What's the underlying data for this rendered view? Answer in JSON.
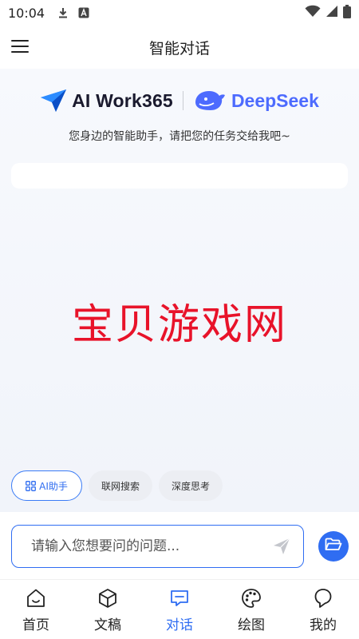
{
  "status_bar": {
    "time": "10:04"
  },
  "header": {
    "title": "智能对话"
  },
  "brand": {
    "left_name": "AI Work365",
    "right_name": "DeepSeek"
  },
  "tagline": "您身边的智能助手，请把您的任务交给我吧~",
  "watermark": "宝贝游戏网",
  "chips": [
    {
      "label": "AI助手",
      "icon": "grid-icon",
      "active": true
    },
    {
      "label": "联网搜索",
      "active": false
    },
    {
      "label": "深度思考",
      "active": false
    }
  ],
  "input": {
    "placeholder": "请输入您想要问的问题...",
    "value": ""
  },
  "tabs": [
    {
      "label": "首页",
      "icon": "home-icon",
      "active": false
    },
    {
      "label": "文稿",
      "icon": "cube-icon",
      "active": false
    },
    {
      "label": "对话",
      "icon": "chat-icon",
      "active": true
    },
    {
      "label": "绘图",
      "icon": "palette-icon",
      "active": false
    },
    {
      "label": "我的",
      "icon": "profile-icon",
      "active": false
    }
  ],
  "colors": {
    "accent": "#2f6df2",
    "deepseek_blue": "#4d6bfe",
    "watermark_red": "#e8132a"
  }
}
